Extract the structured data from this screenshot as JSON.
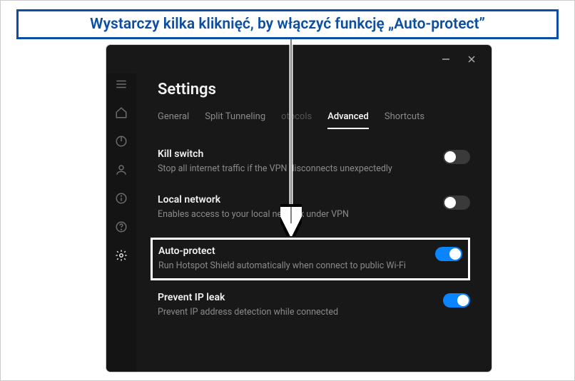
{
  "annotation": "Wystarczy kilka kliknięć, by włączyć funkcję „Auto-protect”",
  "page_title": "Settings",
  "tabs": {
    "general": "General",
    "split": "Split Tunneling",
    "protocols": "otocols",
    "advanced": "Advanced",
    "shortcuts": "Shortcuts"
  },
  "settings": {
    "killswitch": {
      "title": "Kill switch",
      "desc": "Stop all internet traffic if the VPN disconnects unexpectedly"
    },
    "localnet": {
      "title": "Local network",
      "desc": "Enables access to your local network under VPN"
    },
    "autoprotect": {
      "title": "Auto-protect",
      "desc": "Run Hotspot Shield automatically when connect to public Wi-Fi"
    },
    "ipleak": {
      "title": "Prevent IP leak",
      "desc": "Prevent IP address detection while connected"
    }
  }
}
